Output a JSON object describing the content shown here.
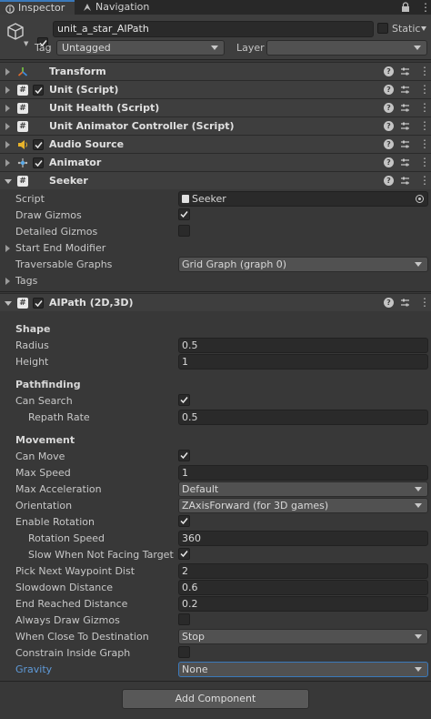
{
  "tabs": [
    {
      "label": "Inspector",
      "active": true,
      "icon": "info-icon"
    },
    {
      "label": "Navigation",
      "active": false,
      "icon": "navigation-icon"
    }
  ],
  "gameobject": {
    "active": true,
    "name": "unit_a_star_AIPath",
    "static_label": "Static",
    "static": false,
    "tag_label": "Tag",
    "tag_value": "Untagged",
    "layer_label": "Layer",
    "layer_value": ""
  },
  "components": [
    {
      "name": "Transform",
      "icon": "transform-icon",
      "has_checkbox": false,
      "expanded": false
    },
    {
      "name": "Unit (Script)",
      "icon": "script-icon",
      "has_checkbox": true,
      "enabled": true,
      "expanded": false
    },
    {
      "name": "Unit Health (Script)",
      "icon": "script-icon",
      "has_checkbox": false,
      "expanded": false
    },
    {
      "name": "Unit Animator Controller (Script)",
      "icon": "script-icon",
      "has_checkbox": false,
      "expanded": false
    },
    {
      "name": "Audio Source",
      "icon": "audio-source-icon",
      "has_checkbox": true,
      "enabled": true,
      "expanded": false
    },
    {
      "name": "Animator",
      "icon": "animator-icon",
      "has_checkbox": true,
      "enabled": true,
      "expanded": false
    },
    {
      "name": "Seeker",
      "icon": "script-icon",
      "has_checkbox": false,
      "expanded": true
    },
    {
      "name": "AIPath (2D,3D)",
      "icon": "script-icon",
      "has_checkbox": true,
      "enabled": true,
      "expanded": true
    }
  ],
  "seeker": {
    "script_label": "Script",
    "script_value": "Seeker",
    "draw_gizmos_label": "Draw Gizmos",
    "draw_gizmos": true,
    "detailed_gizmos_label": "Detailed Gizmos",
    "detailed_gizmos": false,
    "start_end_modifier_label": "Start End Modifier",
    "traversable_graphs_label": "Traversable Graphs",
    "traversable_graphs_value": "Grid Graph (graph 0)",
    "tags_label": "Tags"
  },
  "aipath": {
    "shape_header": "Shape",
    "radius_label": "Radius",
    "radius": "0.5",
    "height_label": "Height",
    "height": "1",
    "pathfinding_header": "Pathfinding",
    "can_search_label": "Can Search",
    "can_search": true,
    "repath_rate_label": "Repath Rate",
    "repath_rate": "0.5",
    "movement_header": "Movement",
    "can_move_label": "Can Move",
    "can_move": true,
    "max_speed_label": "Max Speed",
    "max_speed": "1",
    "max_acceleration_label": "Max Acceleration",
    "max_acceleration": "Default",
    "orientation_label": "Orientation",
    "orientation": "ZAxisForward (for 3D games)",
    "enable_rotation_label": "Enable Rotation",
    "enable_rotation": true,
    "rotation_speed_label": "Rotation Speed",
    "rotation_speed": "360",
    "slow_when_not_facing_label": "Slow When Not Facing Target",
    "slow_when_not_facing": true,
    "pick_next_waypoint_label": "Pick Next Waypoint Dist",
    "pick_next_waypoint": "2",
    "slowdown_distance_label": "Slowdown Distance",
    "slowdown_distance": "0.6",
    "end_reached_label": "End Reached Distance",
    "end_reached": "0.2",
    "always_draw_gizmos_label": "Always Draw Gizmos",
    "always_draw_gizmos": false,
    "when_close_label": "When Close To Destination",
    "when_close": "Stop",
    "constrain_label": "Constrain Inside Graph",
    "constrain": false,
    "gravity_label": "Gravity",
    "gravity": "None"
  },
  "add_component_label": "Add Component",
  "colors": {
    "background": "#383838",
    "header": "#3e3e3e",
    "field": "#2a2a2a",
    "accent": "#3a79bb",
    "highlight_label": "#5f9ad8"
  }
}
